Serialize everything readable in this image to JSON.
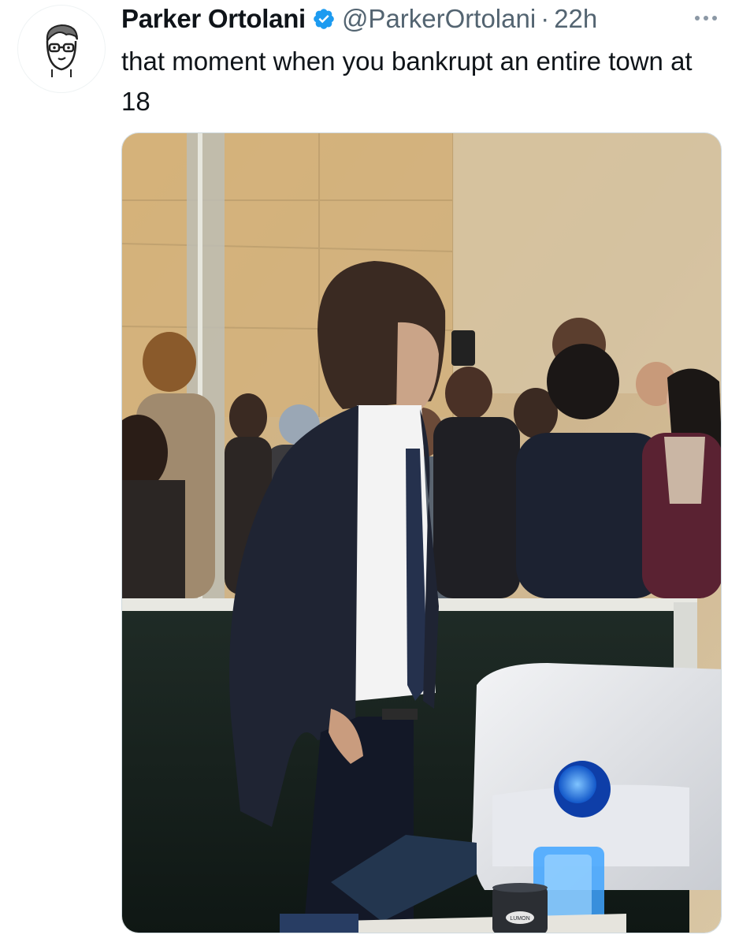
{
  "tweet": {
    "author": {
      "display_name": "Parker Ortolani",
      "handle": "@ParkerOrtolani",
      "verified": true,
      "avatar_icon": "cartoon-face-avatar"
    },
    "time_separator": "·",
    "time": "22h",
    "more_icon": "more-horizontal-icon",
    "text": "that moment when you bankrupt an entire town at 18",
    "media": {
      "type": "photo",
      "mug_label": "LUMON"
    }
  },
  "colors": {
    "verified_blue": "#1d9bf0",
    "text_primary": "#0f1419",
    "text_secondary": "#536471"
  }
}
